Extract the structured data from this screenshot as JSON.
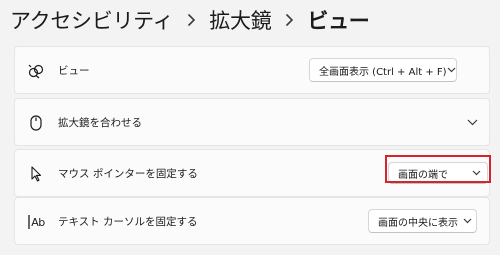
{
  "breadcrumb": {
    "items": [
      "アクセシビリティ",
      "拡大鏡",
      "ビュー"
    ]
  },
  "settings": [
    {
      "icon": "view-glasses-icon",
      "label": "ビュー",
      "control": "dropdown",
      "value": "全画面表示 (Ctrl + Alt + F)"
    },
    {
      "icon": "mouse-icon",
      "label": "拡大鏡を合わせる",
      "control": "expand"
    },
    {
      "icon": "pointer-cursor-icon",
      "label": "マウス ポインターを固定する",
      "control": "dropdown",
      "value": "画面の端で",
      "highlighted": true
    },
    {
      "icon": "text-cursor-icon",
      "icon_text": "Ab",
      "label": "テキスト カーソルを固定する",
      "control": "dropdown",
      "value": "画面の中央に表示"
    }
  ],
  "colors": {
    "background": "#f3f3f3",
    "card": "#fbfbfb",
    "highlight": "#d4242c"
  }
}
